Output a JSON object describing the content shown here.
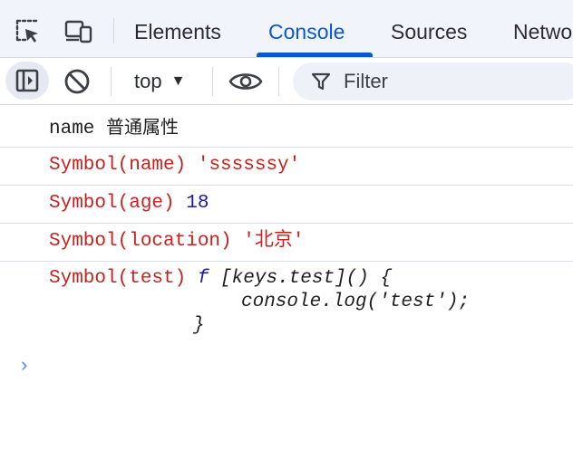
{
  "tabs": {
    "elements": "Elements",
    "console": "Console",
    "sources": "Sources",
    "network": "Netwo"
  },
  "toolbar": {
    "context": "top",
    "filter_placeholder": "Filter"
  },
  "logs": {
    "row1": {
      "a": "name",
      "b": "普通属性"
    },
    "row2": {
      "a": "Symbol(name)",
      "b": "'ssssssy'"
    },
    "row3": {
      "a": "Symbol(age)",
      "b": "18"
    },
    "row4": {
      "a": "Symbol(location)",
      "b": "'北京'"
    },
    "row5": {
      "a": "Symbol(test)",
      "f": "f",
      "line1": "[keys.test]() {",
      "line2": "console.log('test');",
      "line3": "}"
    }
  },
  "prompt": "›",
  "colors": {
    "accent": "#0b57d0",
    "symbol_red": "#c5221f",
    "number_blue": "#1a1aa6"
  },
  "icons": [
    "inspect-icon",
    "device-toolbar-icon",
    "sidebar-toggle-icon",
    "clear-console-icon",
    "caret-down-icon",
    "eye-icon",
    "filter-icon"
  ]
}
